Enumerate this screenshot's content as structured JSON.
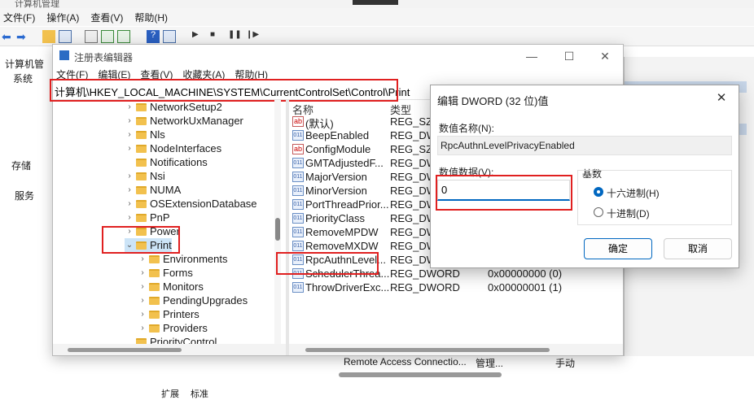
{
  "background_app": {
    "title_fragment": "计算机管理",
    "menu": [
      "文件(F)",
      "操作(A)",
      "查看(V)",
      "帮助(H)"
    ],
    "tree": [
      "计算机管",
      "系统",
      "存储",
      "服务"
    ],
    "bottom_row": {
      "name": "Remote Access Connectio...",
      "desc": "管理...",
      "start": "手动"
    },
    "tabs": [
      "扩展",
      "标准"
    ]
  },
  "regedit": {
    "title": "注册表编辑器",
    "menu": [
      "文件(F)",
      "编辑(E)",
      "查看(V)",
      "收藏夹(A)",
      "帮助(H)"
    ],
    "address": "计算机\\HKEY_LOCAL_MACHINE\\SYSTEM\\CurrentControlSet\\Control\\Print",
    "tree": [
      {
        "label": "NetworkSetup2",
        "level": 0,
        "expander": "›"
      },
      {
        "label": "NetworkUxManager",
        "level": 0,
        "expander": "›"
      },
      {
        "label": "Nls",
        "level": 0,
        "expander": "›"
      },
      {
        "label": "NodeInterfaces",
        "level": 0,
        "expander": "›"
      },
      {
        "label": "Notifications",
        "level": 0,
        "expander": ""
      },
      {
        "label": "Nsi",
        "level": 0,
        "expander": "›"
      },
      {
        "label": "NUMA",
        "level": 0,
        "expander": "›"
      },
      {
        "label": "OSExtensionDatabase",
        "level": 0,
        "expander": "›"
      },
      {
        "label": "PnP",
        "level": 0,
        "expander": "›"
      },
      {
        "label": "Power",
        "level": 0,
        "expander": "›"
      },
      {
        "label": "Print",
        "level": 0,
        "expander": "⌄"
      },
      {
        "label": "Environments",
        "level": 1,
        "expander": "›"
      },
      {
        "label": "Forms",
        "level": 1,
        "expander": "›"
      },
      {
        "label": "Monitors",
        "level": 1,
        "expander": "›"
      },
      {
        "label": "PendingUpgrades",
        "level": 1,
        "expander": "›"
      },
      {
        "label": "Printers",
        "level": 1,
        "expander": "›"
      },
      {
        "label": "Providers",
        "level": 1,
        "expander": "›"
      },
      {
        "label": "PriorityControl",
        "level": 0,
        "expander": ""
      }
    ],
    "columns": {
      "name": "名称",
      "type": "类型"
    },
    "values": [
      {
        "name": "(默认)",
        "type": "REG_SZ",
        "data": "",
        "icon": "ab"
      },
      {
        "name": "BeepEnabled",
        "type": "REG_DW",
        "data": "",
        "icon": "011"
      },
      {
        "name": "ConfigModule",
        "type": "REG_SZ",
        "data": "",
        "icon": "ab"
      },
      {
        "name": "GMTAdjustedF...",
        "type": "REG_DW",
        "data": "",
        "icon": "011"
      },
      {
        "name": "MajorVersion",
        "type": "REG_DW",
        "data": "",
        "icon": "011"
      },
      {
        "name": "MinorVersion",
        "type": "REG_DW",
        "data": "",
        "icon": "011"
      },
      {
        "name": "PortThreadPrior...",
        "type": "REG_DW",
        "data": "",
        "icon": "011"
      },
      {
        "name": "PriorityClass",
        "type": "REG_DW",
        "data": "",
        "icon": "011"
      },
      {
        "name": "RemoveMPDW",
        "type": "REG_DW",
        "data": "",
        "icon": "011"
      },
      {
        "name": "RemoveMXDW",
        "type": "REG_DW",
        "data": "",
        "icon": "011"
      },
      {
        "name": "RpcAuthnLevel...",
        "type": "REG_DW",
        "data": "",
        "icon": "011"
      },
      {
        "name": "SchedulerThrea...",
        "type": "REG_DWORD",
        "data": "0x00000000 (0)",
        "icon": "011"
      },
      {
        "name": "ThrowDriverExc...",
        "type": "REG_DWORD",
        "data": "0x00000001 (1)",
        "icon": "011"
      }
    ]
  },
  "dialog": {
    "title": "编辑 DWORD (32 位)值",
    "name_label": "数值名称(N):",
    "name_value": "RpcAuthnLevelPrivacyEnabled",
    "data_label": "数值数据(V):",
    "data_value": "0",
    "base_label": "基数",
    "radio_hex": "十六进制(H)",
    "radio_dec": "十进制(D)",
    "ok": "确定",
    "cancel": "取消",
    "close": "✕"
  }
}
